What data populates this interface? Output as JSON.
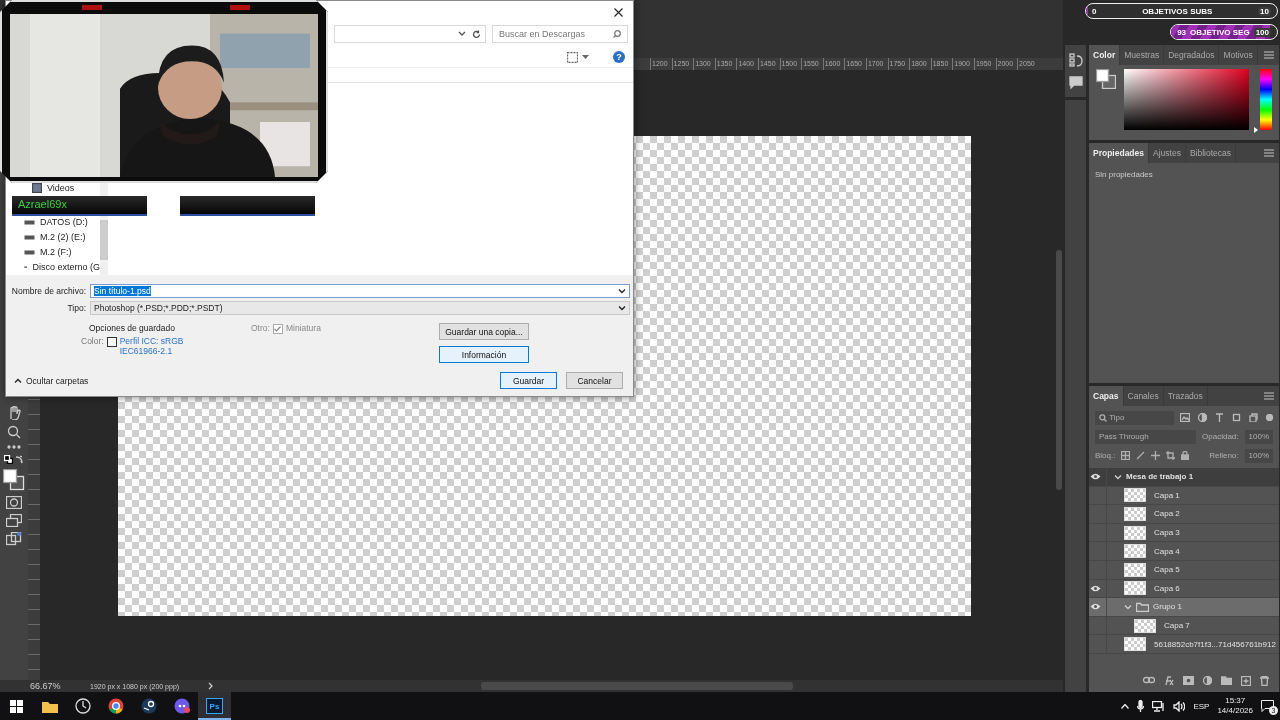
{
  "dialog": {
    "search": {
      "placeholder": "Buscar en Descargas"
    },
    "help": "?",
    "nav_items": [
      {
        "label": "Videos",
        "kind": "folder"
      },
      {
        "label": "DATOS (D:)",
        "kind": "drive"
      },
      {
        "label": "M.2 (2) (E:)",
        "kind": "drive"
      },
      {
        "label": "M.2 (F:)",
        "kind": "drive"
      },
      {
        "label": "Disco externo (G",
        "kind": "drive"
      }
    ],
    "filename": {
      "label": "Nombre de archivo:",
      "value": "Sin título-1.psd",
      "value_selected": true
    },
    "type": {
      "label": "Tipo:",
      "value": "Photoshop (*.PSD;*.PDD;*.PSDT)"
    },
    "save_options": {
      "title": "Opciones de guardado",
      "color_label": "Color:",
      "color_checked": false,
      "color_profile": "Perfil ICC: sRGB IEC61966-2.1",
      "other_label": "Otro:",
      "thumbnail_label": "Miniatura",
      "thumbnail_checked": true
    },
    "side_buttons": [
      {
        "label": "Guardar una copia...",
        "highlighted": false
      },
      {
        "label": "Información",
        "highlighted": true
      }
    ],
    "buttons": [
      {
        "label": "Guardar",
        "highlighted": true
      },
      {
        "label": "Cancelar",
        "highlighted": false
      }
    ],
    "hide_folders": "Ocultar carpetas"
  },
  "webcam": {
    "kind": "picture",
    "nameplate": "Azrael69x"
  },
  "stream_goals": [
    {
      "start": "0",
      "title": "OBJETIVOS SUBS",
      "end": "10",
      "level": 0
    },
    {
      "start": "93",
      "title": "OBJETIVO SEG",
      "end": "100",
      "level": 0.93
    }
  ],
  "photoshop": {
    "ruler_labels": [
      "1200",
      "1250",
      "1300",
      "1350",
      "1400",
      "1450",
      "1500",
      "1550",
      "1600",
      "1650",
      "1700",
      "1750",
      "1800",
      "1850",
      "1900",
      "1950",
      "2000",
      "2050"
    ],
    "status": {
      "zoom": "66.67%",
      "doc_info": "1920 px x 1080 px (200 ppp)"
    },
    "color_panel": {
      "tabs": [
        {
          "label": "Color",
          "selected": true
        },
        {
          "label": "Muestras",
          "selected": false
        },
        {
          "label": "Degradados",
          "selected": false
        },
        {
          "label": "Motivos",
          "selected": false
        }
      ],
      "hue_slider": {
        "level": 0
      }
    },
    "properties_panel": {
      "tabs": [
        {
          "label": "Propiedades",
          "selected": true
        },
        {
          "label": "Ajustes",
          "selected": false
        },
        {
          "label": "Bibliotecas",
          "selected": false
        }
      ],
      "empty_text": "Sin propiedades"
    },
    "layers_panel": {
      "tabs": [
        {
          "label": "Capas",
          "selected": true
        },
        {
          "label": "Canales",
          "selected": false
        },
        {
          "label": "Trazados",
          "selected": false
        }
      ],
      "search": {
        "placeholder": "Tipo"
      },
      "blend_mode": "Pass Through",
      "opacity_label": "Opacidad:",
      "opacity": "100%",
      "lock_label": "Bloq.:",
      "fill_label": "Relleno:",
      "fill": "100%",
      "layers": [
        {
          "name": "Mesa de trabajo 1",
          "kind": "artboard",
          "visible": true,
          "selected": false,
          "expanded": true,
          "children": [
            {
              "name": "Capa 1",
              "kind": "layer",
              "visible": false,
              "selected": false
            },
            {
              "name": "Capa 2",
              "kind": "layer",
              "visible": false,
              "selected": false
            },
            {
              "name": "Capa 3",
              "kind": "layer",
              "visible": false,
              "selected": false
            },
            {
              "name": "Capa 4",
              "kind": "layer",
              "visible": false,
              "selected": false
            },
            {
              "name": "Capa 5",
              "kind": "layer",
              "visible": false,
              "selected": false
            },
            {
              "name": "Capa 6",
              "kind": "layer",
              "visible": true,
              "selected": false
            },
            {
              "name": "Grupo 1",
              "kind": "group",
              "visible": true,
              "selected": true,
              "expanded": true,
              "children": [
                {
                  "name": "Capa 7",
                  "kind": "layer",
                  "visible": false,
                  "selected": false
                }
              ]
            },
            {
              "name": "5618852cb7f1f3...71d456761b912",
              "kind": "layer",
              "visible": false,
              "selected": false
            }
          ]
        }
      ]
    }
  },
  "taskbar": {
    "apps": [
      {
        "kind": "folder",
        "selected": false
      },
      {
        "kind": "clock",
        "selected": false
      },
      {
        "kind": "browser",
        "selected": false
      },
      {
        "kind": "steam",
        "selected": false
      },
      {
        "kind": "chat",
        "selected": false
      },
      {
        "label": "Ps",
        "selected": true
      }
    ],
    "language": "ESP",
    "time": "15:37",
    "date": "14/4/2026",
    "notifications": "3"
  }
}
